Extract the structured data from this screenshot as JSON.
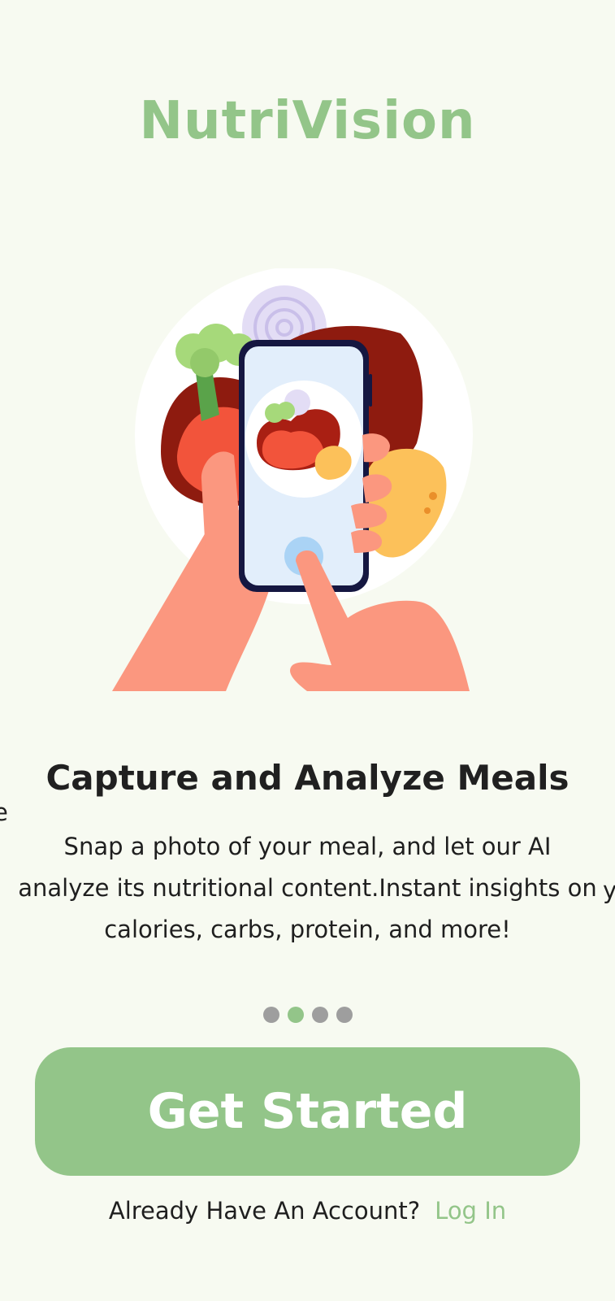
{
  "app": {
    "title": "NutriVision"
  },
  "onboarding": {
    "illustration": "phone-scanning-meal-illustration",
    "title": "Capture and Analyze Meals",
    "description": "Snap a photo of your meal, and let our AI analyze its nutritional content.Instant insights on calories, carbs, protein, and more!",
    "peek_prev_text": "e",
    "peek_next_text": "y",
    "pager": {
      "total": 4,
      "active_index": 1
    }
  },
  "actions": {
    "primary_label": "Get Started",
    "login_prompt": "Already Have An Account?",
    "login_link": "Log In"
  },
  "colors": {
    "background": "#f7faf1",
    "accent": "#93c589",
    "text": "#1f1f1f",
    "dot_inactive": "#9e9e9e"
  }
}
